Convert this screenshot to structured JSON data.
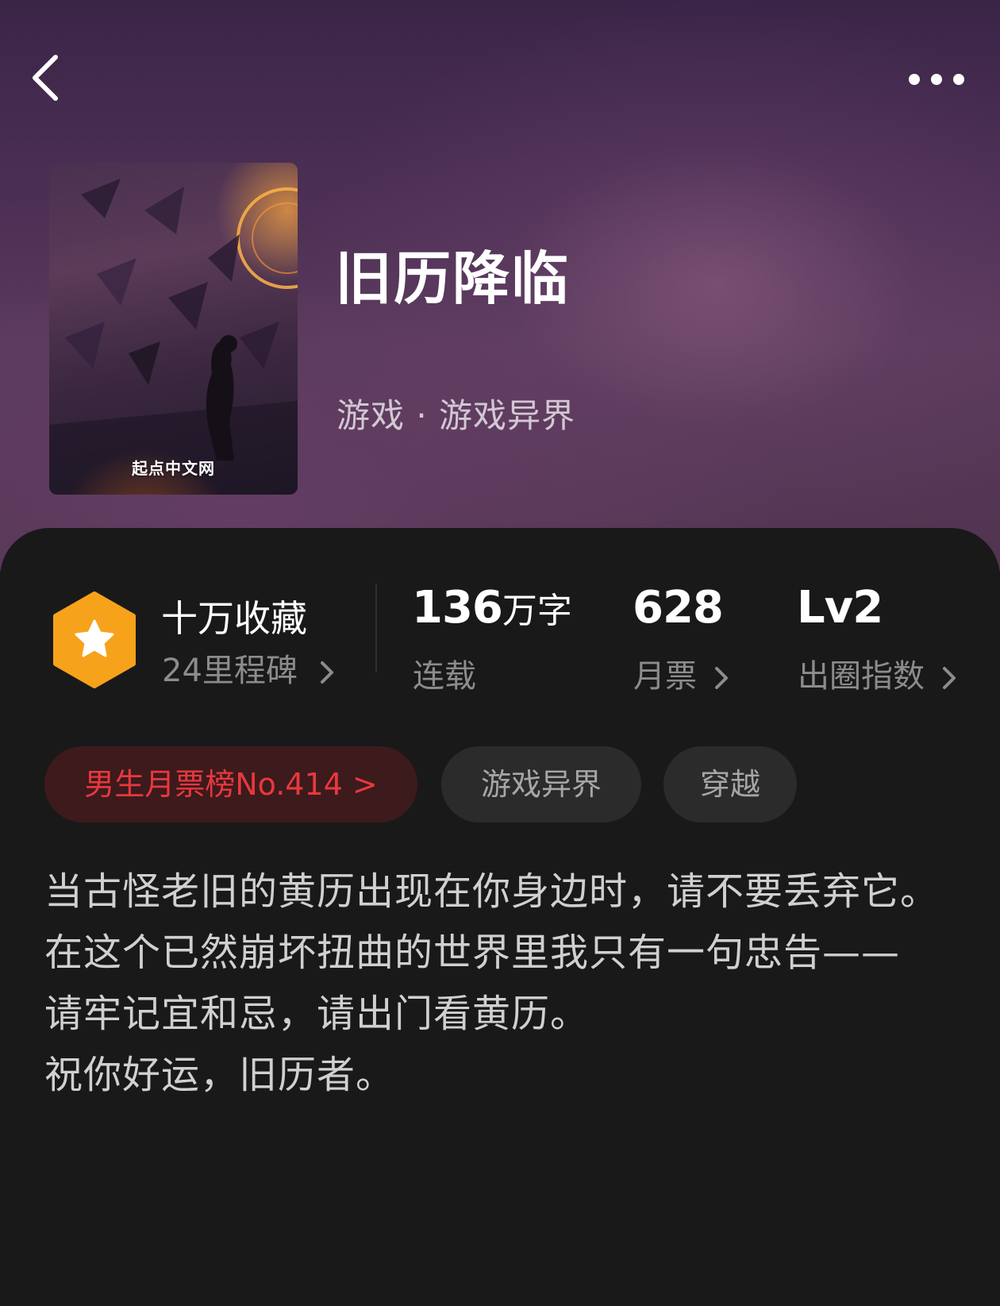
{
  "header": {
    "back_icon": "chevron-left-icon",
    "more_icon": "more-horizontal-icon"
  },
  "book": {
    "title": "旧历降临",
    "genre": "游戏 · 游戏异界",
    "cover_logo": "起点中文网"
  },
  "stats": {
    "milestone": {
      "icon": "star-hexagon-icon",
      "label": "十万收藏",
      "sub": "24里程碑"
    },
    "words": {
      "value": "136",
      "unit": "万字",
      "sub": "连载"
    },
    "monthly_tickets": {
      "value": "628",
      "sub": "月票"
    },
    "influence": {
      "value": "Lv2",
      "sub": "出圈指数"
    }
  },
  "tags": [
    {
      "label": "男生月票榜No.414 >"
    },
    {
      "label": "游戏异界"
    },
    {
      "label": "穿越"
    }
  ],
  "description": [
    "当古怪老旧的黄历出现在你身边时，请不要丢弃它。",
    "在这个已然崩坏扭曲的世界里我只有一句忠告——",
    "请牢记宜和忌，请出门看黄历。",
    "祝你好运，旧历者。"
  ],
  "colors": {
    "accent_red": "#e8383e",
    "badge_orange": "#f7a21b",
    "card_bg": "#191919"
  }
}
